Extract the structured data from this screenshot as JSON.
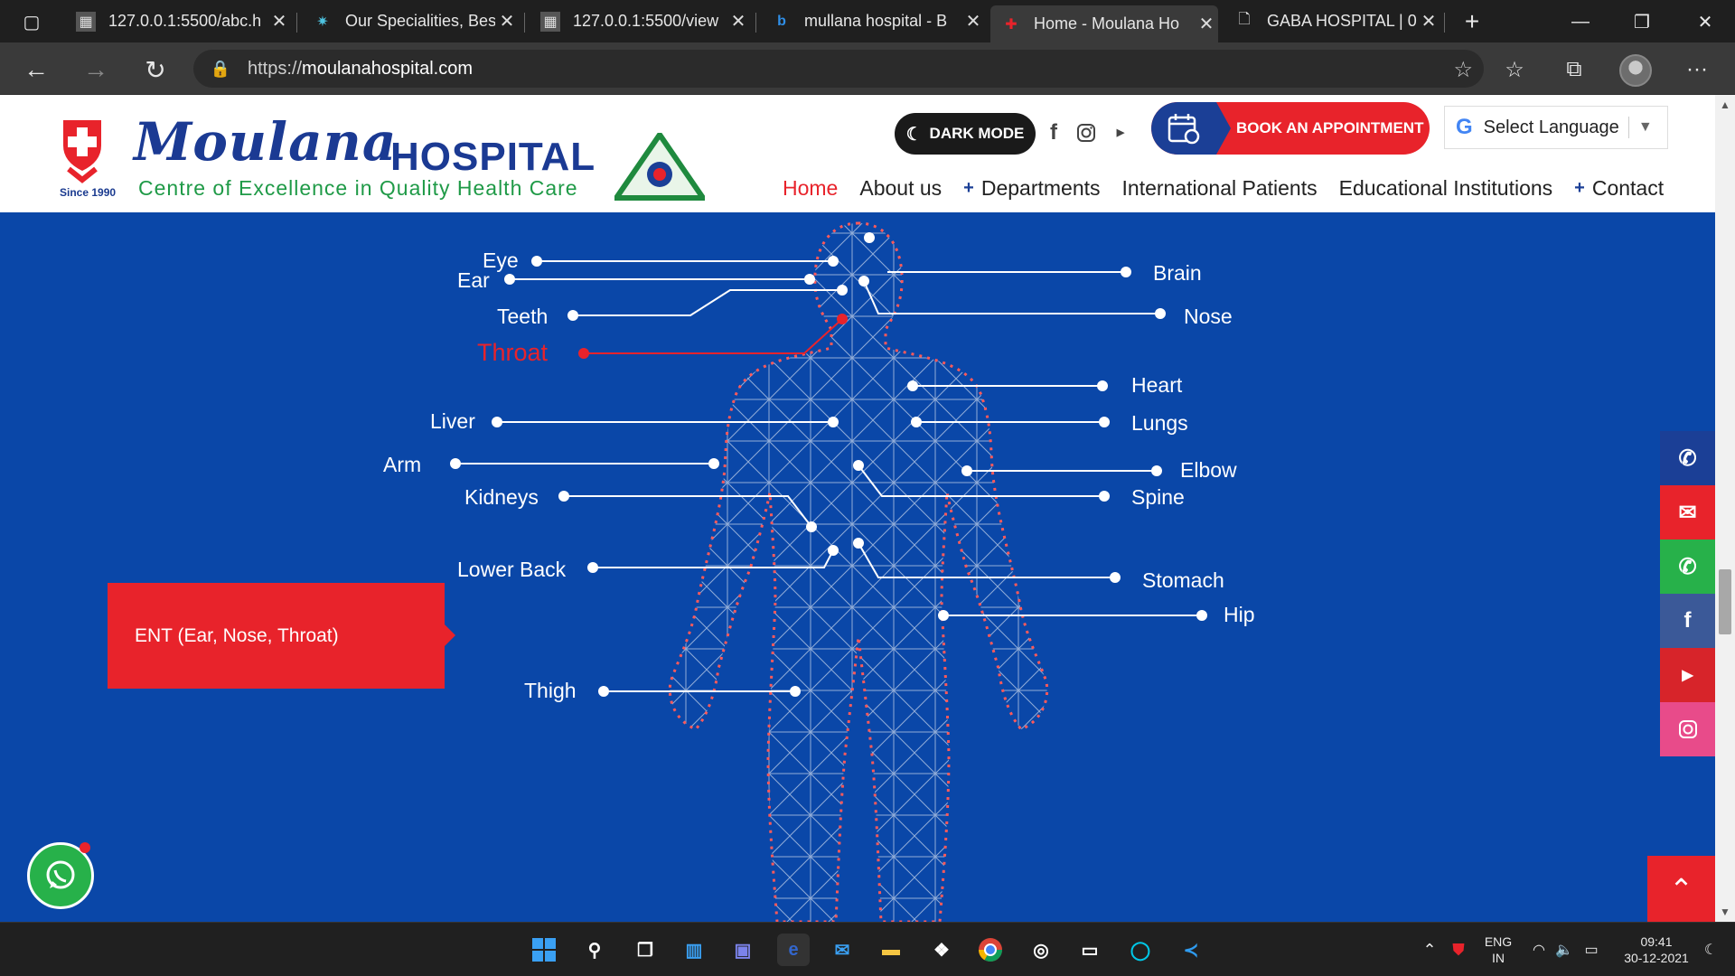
{
  "browser": {
    "tabs": [
      {
        "title": "127.0.0.1:5500/abc.h",
        "active": false
      },
      {
        "title": "Our Specialities, Bes",
        "active": false
      },
      {
        "title": "127.0.0.1:5500/view",
        "active": false
      },
      {
        "title": "mullana hospital - B",
        "active": false
      },
      {
        "title": "Home - Moulana Ho",
        "active": true
      },
      {
        "title": "GABA HOSPITAL | 0",
        "active": false
      }
    ],
    "url_scheme": "https://",
    "url_host": "moulanahospital.com"
  },
  "header": {
    "since": "Since 1990",
    "brand": "Moulana",
    "brand_suffix": "HOSPITAL",
    "tagline": "Centre of Excellence in Quality Health Care",
    "dark_mode": "DARK MODE",
    "book_appointment": "BOOK AN APPOINTMENT",
    "language": "Select Language",
    "nav": [
      "Home",
      "About us",
      "Departments",
      "International Patients",
      "Educational Institutions",
      "Contact"
    ]
  },
  "bodymap": {
    "selected_department": "ENT (Ear, Nose, Throat)",
    "selected_organ": "Throat",
    "left_labels": [
      "Eye",
      "Ear",
      "Teeth",
      "Throat",
      "Liver",
      "Arm",
      "Kidneys",
      "Lower Back",
      "Thigh"
    ],
    "right_labels": [
      "Brain",
      "Nose",
      "Heart",
      "Lungs",
      "Elbow",
      "Spine",
      "Stomach",
      "Hip"
    ]
  },
  "taskbar": {
    "lang": "ENG",
    "region": "IN",
    "time": "09:41",
    "date": "30-12-2021"
  },
  "colors": {
    "brand_red": "#e8232b",
    "brand_blue": "#1b3f96",
    "hero_blue": "#0a47a8"
  }
}
